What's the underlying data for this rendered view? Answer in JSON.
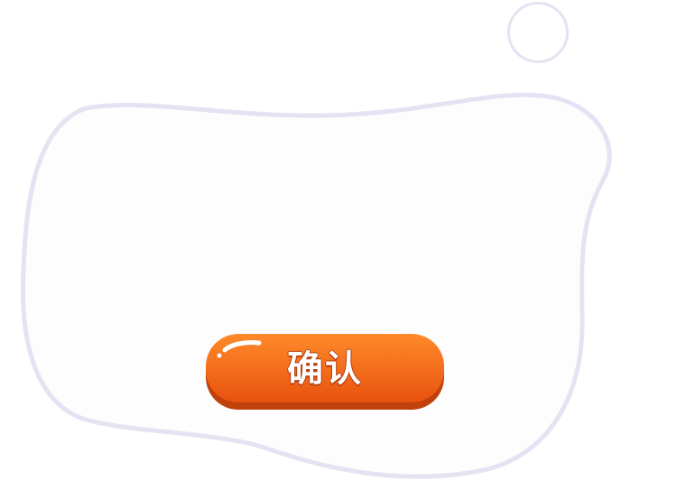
{
  "dialog": {
    "confirm_label": "确认"
  },
  "colors": {
    "panel_fill": "#fdfdfd",
    "panel_border": "#e4e3f3",
    "button_top": "#ff8a2a",
    "button_bottom": "#e8520f",
    "button_shadow": "#c0410b"
  },
  "icons": {
    "close": "circle-outline-icon"
  }
}
